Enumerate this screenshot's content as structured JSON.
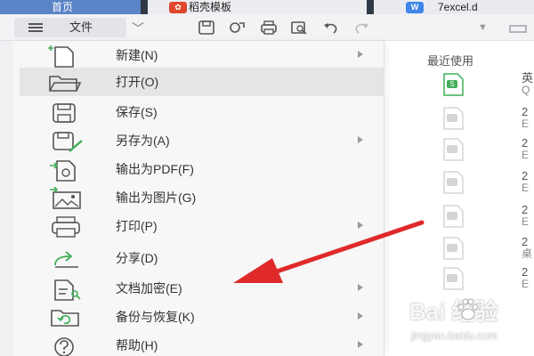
{
  "tabs": [
    {
      "label": "首页"
    },
    {
      "label": "稻壳模板",
      "icon": "docer-logo-icon"
    },
    {
      "label": "7excel.d",
      "icon": "w-document-icon"
    }
  ],
  "tab_icons": {
    "docer": "✿",
    "writer": "W"
  },
  "toolbar": {
    "file_label": "文件",
    "icons": [
      "save-icon",
      "save-as-icon",
      "print-icon",
      "print-preview-icon",
      "undo-icon",
      "redo-icon",
      "dropdown-icon"
    ]
  },
  "menu": {
    "items": [
      {
        "label": "新建(N)",
        "icon": "new-file-icon",
        "submenu": true
      },
      {
        "label": "打开(O)",
        "icon": "folder-open-icon",
        "submenu": false,
        "highlighted": true
      },
      {
        "label": "保存(S)",
        "icon": "save-icon",
        "submenu": false
      },
      {
        "label": "另存为(A)",
        "icon": "save-as-icon",
        "submenu": true
      },
      {
        "label": "输出为PDF(F)",
        "icon": "export-pdf-icon",
        "submenu": false
      },
      {
        "label": "输出为图片(G)",
        "icon": "export-image-icon",
        "submenu": false
      },
      {
        "label": "打印(P)",
        "icon": "print-icon",
        "submenu": true
      },
      {
        "label": "分享(D)",
        "icon": "share-icon",
        "submenu": false
      },
      {
        "label": "文档加密(E)",
        "icon": "encrypt-document-icon",
        "submenu": true
      },
      {
        "label": "备份与恢复(K)",
        "icon": "backup-restore-icon",
        "submenu": true
      },
      {
        "label": "帮助(H)",
        "icon": "help-icon",
        "submenu": true
      }
    ]
  },
  "recent": {
    "title": "最近使用",
    "files": [
      {
        "line1": "英",
        "line2": "Q",
        "icon": "spreadsheet-icon"
      },
      {
        "line1": "2",
        "line2": "E",
        "icon": "spreadsheet-icon"
      },
      {
        "line1": "2",
        "line2": "E",
        "icon": "spreadsheet-icon"
      },
      {
        "line1": "2",
        "line2": "E",
        "icon": "spreadsheet-icon"
      },
      {
        "line1": "2",
        "line2": "E",
        "icon": "spreadsheet-icon"
      },
      {
        "line1": "2",
        "line2": "桌",
        "icon": "spreadsheet-icon"
      },
      {
        "line1": "2",
        "line2": "E",
        "icon": "spreadsheet-icon"
      }
    ]
  },
  "annotation": {
    "type": "red-arrow",
    "points_to": "文档加密(E)",
    "color": "#e02a2a"
  },
  "watermark": {
    "logo": "Bai 经验",
    "url": "jingyan.baidu.com",
    "icon": "baidu-paw-icon"
  },
  "colors": {
    "home_tab": "#5b84c7",
    "highlight": "#e4e5e7",
    "accent_green": "#3fae57",
    "arrow_red": "#e02a2a"
  }
}
